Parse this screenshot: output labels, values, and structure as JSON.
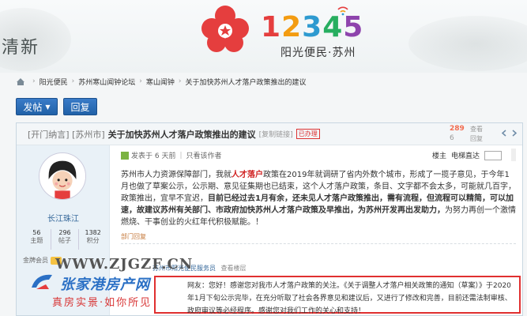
{
  "header": {
    "logo_numbers": [
      "1",
      "2",
      "3",
      "4",
      "5"
    ],
    "logo_subtitle": "阳光便民·苏州",
    "ink_calligraphy": "清新"
  },
  "breadcrumb": [
    "阳光便民",
    "苏州寒山闻钟论坛",
    "寒山闻钟",
    "关于加快苏州人才落户政策推出的建议"
  ],
  "toolbar": {
    "post_label": "发帖",
    "reply_label": "回复"
  },
  "post": {
    "tags": "[开门纳言] [苏州市]",
    "title": "关于加快苏州人才落户政策推出的建议",
    "copy_link": "[复制链接]",
    "status_badge": "已办理",
    "stats": {
      "views": "289",
      "views_label": "查看",
      "replies": "6",
      "replies_label": "回复"
    },
    "author": {
      "username": "长江珠江",
      "threads": "56",
      "threads_label": "主题",
      "posts": "296",
      "posts_label": "帖子",
      "points": "1382",
      "points_label": "积分",
      "member_label": "金牌会员"
    },
    "meta": {
      "posted": "发表于 6 天前",
      "only_author": "只看该作者",
      "floor": "楼主",
      "jump_label": "电梯直达"
    },
    "body": {
      "p1": "苏州市人力资源保障部门，我就",
      "p1_hl": "人才落户",
      "p1_rest": "政策在2019年就调研了省内外数个城市，形成了一揽子意见，于今年1月也做了草案公示，公示期、意见征集期也已结束，这个人才落户政策，条目、文字都不会太多，可能就几百字，政策推出，宜早不宜迟，",
      "p1_bold": "目前已经过去1月有余，还未见人才落户政策推出，需有流程，但流程可以精简，可以加速，故建议苏州有关部门、市政府加快苏州人才落户政策及早推出，为苏州开发再出发助力，",
      "p1_end": "为努力再创一个激情燃烧、干事创业的火红年代积极赋能。！"
    },
    "dept_reply_label": "部门回复",
    "service_name": "苏州市阳光便民服务员",
    "service_view": "查看楼层",
    "reply_text": "网友：您好！感谢您对我市人才落户政策的关注。《关于调整人才落户相关政策的通知（草案）》于2020年1月下旬公示完毕，在充分听取了社会各界意见和建议后，又进行了修改和完善，目前还需法制审核、政府审议等必经程序。感谢您对我们工作的关心和支持！"
  },
  "watermark": {
    "url": "WWW.ZJGZF.CN",
    "name": "张家港房产网",
    "slogan": "真房实景·如你所见"
  },
  "colors": {
    "accent_blue": "#2b70c5",
    "alert_red": "#e03030",
    "logo_red": "#e53e3e"
  }
}
